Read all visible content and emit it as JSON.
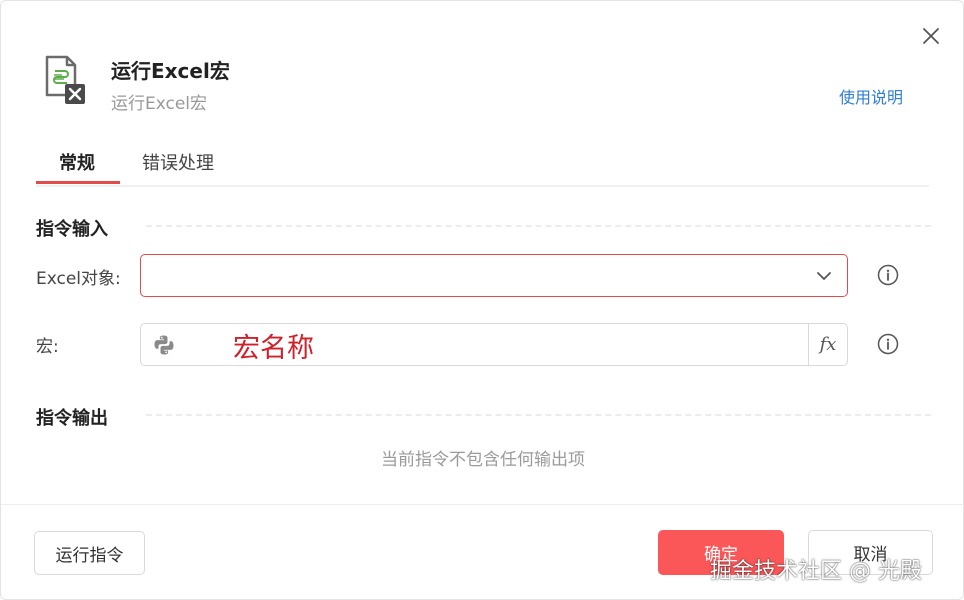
{
  "dialog": {
    "title": "运行Excel宏",
    "subtitle": "运行Excel宏",
    "help_link": "使用说明",
    "header_icon": "excel-macro-icon",
    "close_icon": "close-icon"
  },
  "tabs": [
    {
      "label": "常规",
      "active": true
    },
    {
      "label": "错误处理",
      "active": false
    }
  ],
  "input_section": {
    "title": "指令输入",
    "excel_object": {
      "label": "Excel对象:",
      "value": ""
    },
    "macro": {
      "label": "宏:",
      "value": "宏名称",
      "fx_label": "fx"
    }
  },
  "output_section": {
    "title": "指令输出",
    "empty_text": "当前指令不包含任何输出项"
  },
  "footer": {
    "run_button": "运行指令",
    "ok_button": "确定",
    "cancel_button": "取消"
  },
  "watermark": "掘金技术社区 @ 光殿",
  "colors": {
    "accent": "#e04b4b",
    "primary_button": "#fb5658",
    "link": "#2f7ed8",
    "error_border": "#e5484d"
  }
}
